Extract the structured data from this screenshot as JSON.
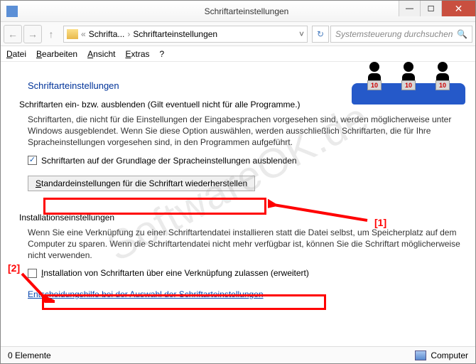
{
  "window": {
    "title": "Schriftarteinstellungen"
  },
  "nav": {
    "back": "←",
    "forward": "→",
    "up": "↑",
    "refresh": "↻",
    "crumb1": "Schrifta...",
    "crumb2": "Schriftarteinstellungen",
    "search_placeholder": "Systemsteuerung durchsuchen"
  },
  "menu": {
    "file": "Datei",
    "edit": "Bearbeiten",
    "view": "Ansicht",
    "extras": "Extras",
    "help": "?"
  },
  "content": {
    "heading": "Schriftarteinstellungen",
    "sub1": "Schriftarten ein- bzw. ausblenden (Gilt eventuell nicht für alle Programme.)",
    "body1": "Schriftarten, die nicht für die Einstellungen der Eingabesprachen vorgesehen sind, werden möglicherweise unter Windows ausgeblendet. Wenn Sie diese Option auswählen, werden ausschließlich Schriftarten, die für Ihre Spracheinstellungen vorgesehen sind, in den Programmen aufgeführt.",
    "check1_label": "Schriftarten auf der Grundlage der Spracheinstellungen ausblenden",
    "restore_btn": "Standardeinstellungen für die Schriftart wiederherstellen",
    "sub2": "Installationseinstellungen",
    "body2": "Wenn Sie eine Verknüpfung zu einer Schriftartendatei installieren statt die Datei selbst, um Speicherplatz auf dem Computer zu sparen. Wenn die Schriftartendatei nicht mehr verfügbar ist, können Sie die Schriftart möglicherweise nicht verwenden.",
    "check2_label": "Installation von Schriftarten über eine Verknüpfung zulassen (erweitert)",
    "help_link": "Entscheidungshilfe bei der Auswahl der Schriftarteinstellungen"
  },
  "annotations": {
    "label1": "[1]",
    "label2": "[2]"
  },
  "status": {
    "left": "0 Elemente",
    "right": "Computer"
  },
  "watermark": "SoftwareOK.de",
  "decor_tag": "10"
}
